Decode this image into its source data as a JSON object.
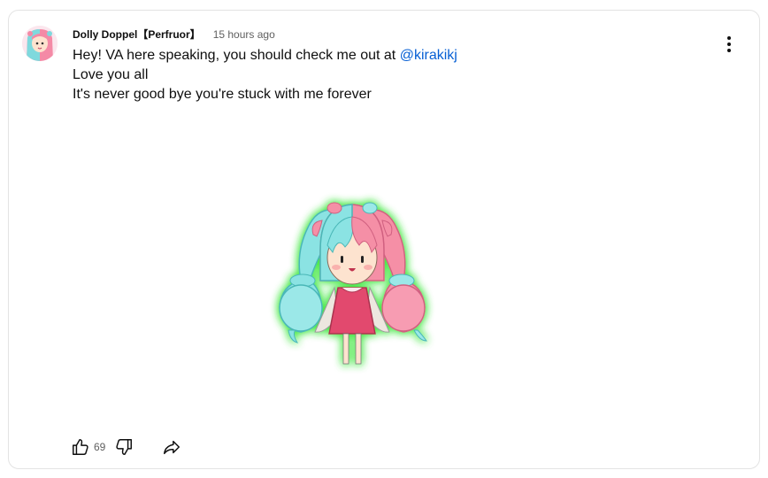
{
  "post": {
    "author": "Dolly Doppel【Perfruor】",
    "timestamp": "15 hours ago",
    "text_line1_prefix": "Hey! VA here speaking, you should check me out at ",
    "mention": "@kirakikj",
    "text_line2": "Love you all",
    "text_line3": "It's never good bye you're stuck with me forever",
    "image_icon": "chibi-character-image"
  },
  "actions": {
    "like_count": "69",
    "like_icon": "thumbs-up-icon",
    "dislike_icon": "thumbs-down-icon",
    "share_icon": "share-icon",
    "menu_icon": "more-vertical-icon"
  },
  "colors": {
    "text": "#0f0f0f",
    "secondary": "#606060",
    "link": "#065fd4",
    "border": "#e3e3e3"
  }
}
